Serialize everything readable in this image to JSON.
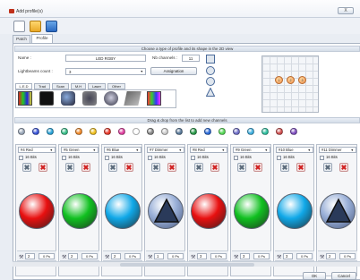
{
  "window": {
    "title": "Add profile(s)",
    "close_label": "X"
  },
  "tabs": [
    "Patch",
    "Profile"
  ],
  "profile": {
    "shape_header": "Choose a type of profile and its shape in the 2D view",
    "name_label": "Name :",
    "name_value": "LED RGBY",
    "nb_channels_label": "Nb channels :",
    "nb_channels_value": "11",
    "lightbeams_label": "Lightbeams count :",
    "lightbeams_value": "3",
    "assignation_label": "Assignation",
    "grid_leds": [
      "1",
      "2",
      "3"
    ]
  },
  "categories": [
    "L.E.D",
    "Trad",
    "Scan",
    "M.H",
    "Laser",
    "Other"
  ],
  "channels_header": "Drag & drop from the list to add new channels",
  "palette_colors": [
    "#9aa7b8",
    "#3a55d8",
    "#2aa3d8",
    "#3bbf8a",
    "#f08a2a",
    "#f0c020",
    "#e83a2a",
    "#e040a0",
    "#ffffff",
    "#888888",
    "#cccccc",
    "#5a7a9a",
    "#2a9a4a",
    "#2a6ad8",
    "#58d858",
    "#7070c8",
    "#40b0e0",
    "#30c0a0",
    "#d05050",
    "#8050c0"
  ],
  "channels": [
    {
      "num": "#4",
      "type": "Red",
      "bits": "16 Bits",
      "color": "#e81010",
      "kind": "ball",
      "count": "2",
      "fade": "0 Ps"
    },
    {
      "num": "#5",
      "type": "Green",
      "bits": "16 Bits",
      "color": "#10c020",
      "kind": "ball",
      "count": "2",
      "fade": "0 Ps"
    },
    {
      "num": "#6",
      "type": "Blue",
      "bits": "16 Bits",
      "color": "#10a8e8",
      "kind": "ball",
      "count": "2",
      "fade": "0 Ps"
    },
    {
      "num": "#7",
      "type": "Dimmer",
      "bits": "16 Bits",
      "color": "#9ab0d8",
      "kind": "dimmer",
      "count": "1",
      "fade": "0 Ps"
    },
    {
      "num": "#8",
      "type": "Red",
      "bits": "16 Bits",
      "color": "#e81010",
      "kind": "ball",
      "count": "3",
      "fade": "0 Ps"
    },
    {
      "num": "#9",
      "type": "Green",
      "bits": "16 Bits",
      "color": "#10c020",
      "kind": "ball",
      "count": "3",
      "fade": "0 Ps"
    },
    {
      "num": "#10",
      "type": "Blue",
      "bits": "16 Bits",
      "color": "#10a8e8",
      "kind": "ball",
      "count": "3",
      "fade": "0 Ps"
    },
    {
      "num": "#11",
      "type": "Dimmer",
      "bits": "16 Bits",
      "color": "#9ab0d8",
      "kind": "dimmer",
      "count": "2",
      "fade": "0 Ps"
    }
  ],
  "dialog": {
    "ok_label": "OK",
    "cancel_label": "Cancel"
  }
}
